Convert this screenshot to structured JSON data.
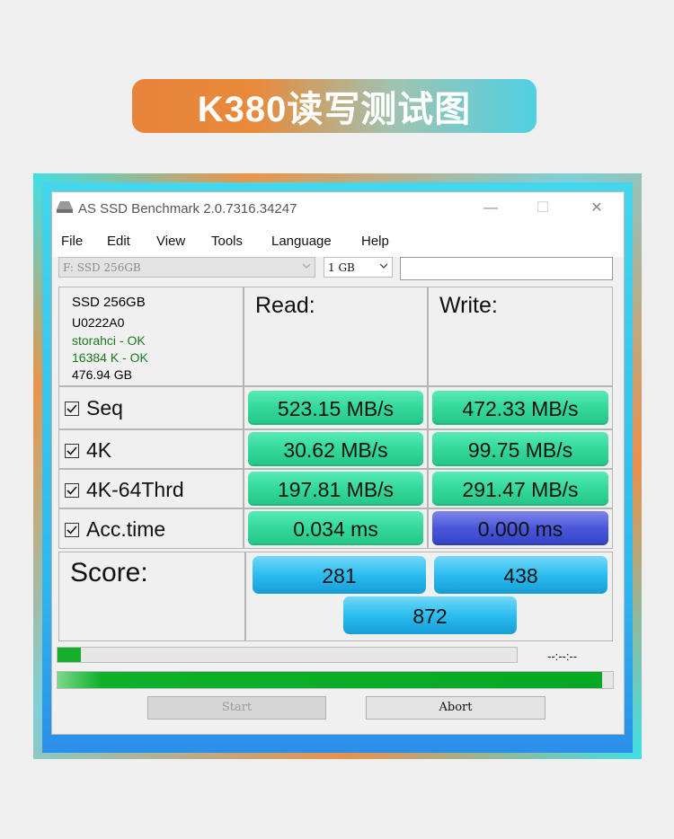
{
  "banner": {
    "title": "K380读写测试图"
  },
  "window": {
    "title": "AS SSD Benchmark 2.0.7316.34247",
    "controls": {
      "minimize": "—",
      "maximize": "☐",
      "close": "✕"
    }
  },
  "menu": [
    "File",
    "Edit",
    "View",
    "Tools",
    "Language",
    "Help"
  ],
  "toolbar": {
    "drive_value": "F: SSD 256GB",
    "size_value": "1 GB",
    "text_value": ""
  },
  "info": {
    "model": "SSD 256GB",
    "firmware": "U0222A0",
    "driver": "storahci - OK",
    "alignment": "16384 K - OK",
    "capacity": "476.94 GB",
    "ok_color": "#1a7a1a"
  },
  "headers": {
    "read": "Read:",
    "write": "Write:"
  },
  "tests": [
    {
      "label": "Seq",
      "read": "523.15 MB/s",
      "write": "472.33 MB/s"
    },
    {
      "label": "4K",
      "read": "30.62 MB/s",
      "write": "99.75 MB/s"
    },
    {
      "label": "4K-64Thrd",
      "read": "197.81 MB/s",
      "write": "291.47 MB/s"
    },
    {
      "label": "Acc.time",
      "read": "0.034 ms",
      "write": "0.000 ms"
    }
  ],
  "score": {
    "label": "Score:",
    "read": "281",
    "write": "438",
    "total": "872"
  },
  "progress": {
    "current_fraction": 0.05,
    "overall_fraction": 0.98,
    "timer": "--:--:--"
  },
  "buttons": {
    "start": "Start",
    "abort": "Abort"
  },
  "colors": {
    "result_green": "#34d89a",
    "result_blue": "#4a56d8",
    "score_blue": "#2cbdf0",
    "progress_green": "#14b02c"
  }
}
